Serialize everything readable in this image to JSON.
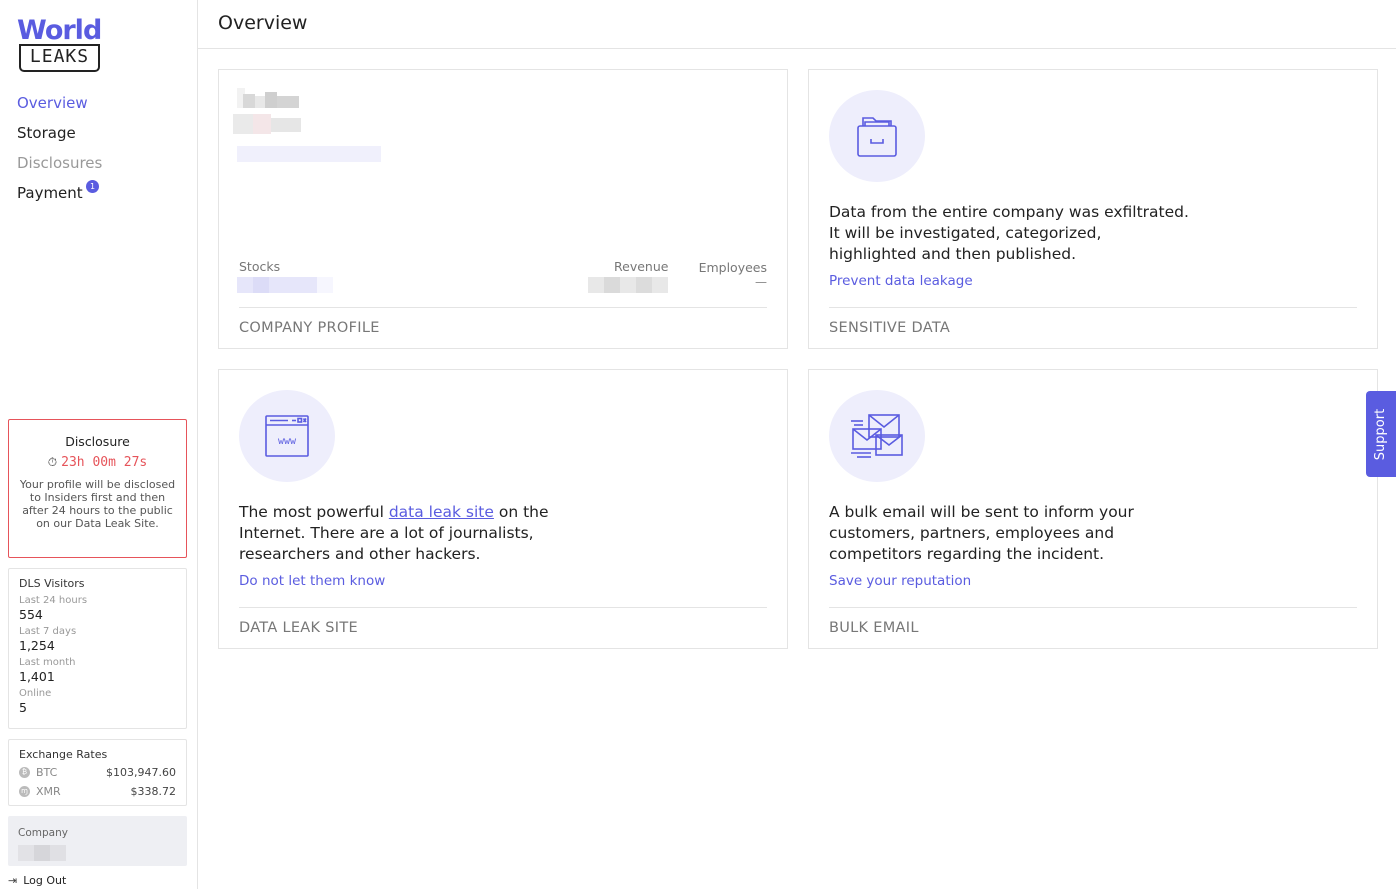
{
  "sidebar": {
    "logo": {
      "top": "World",
      "bottom": "LEAKS"
    },
    "nav": [
      {
        "label": "Overview",
        "state": "active"
      },
      {
        "label": "Storage",
        "state": "normal"
      },
      {
        "label": "Disclosures",
        "state": "muted"
      },
      {
        "label": "Payment",
        "state": "normal",
        "badge": "1"
      }
    ],
    "disclosure": {
      "title": "Disclosure",
      "timer": "23h 00m 27s",
      "text": "Your profile will be disclosed to Insiders first and then after 24 hours to the public on our Data Leak Site."
    },
    "visitors": {
      "title": "DLS Visitors",
      "stats": [
        {
          "label": "Last 24 hours",
          "value": "554"
        },
        {
          "label": "Last 7 days",
          "value": "1,254"
        },
        {
          "label": "Last month",
          "value": "1,401"
        },
        {
          "label": "Online",
          "value": "5"
        }
      ]
    },
    "rates": {
      "title": "Exchange Rates",
      "items": [
        {
          "name": "BTC",
          "value": "$103,947.60",
          "icon": "bitcoin-icon"
        },
        {
          "name": "XMR",
          "value": "$338.72",
          "icon": "monero-icon"
        }
      ]
    },
    "company": {
      "label": "Company"
    },
    "logout": "Log Out"
  },
  "header": {
    "title": "Overview"
  },
  "cards": {
    "profile": {
      "footer": "COMPANY PROFILE",
      "stocks_label": "Stocks",
      "revenue_label": "Revenue",
      "employees_label": "Employees",
      "employees_value": "—"
    },
    "sensitive": {
      "text": "Data from the entire company was exfiltrated. It will be investigated, categorized, highlighted and then published.",
      "link": "Prevent data leakage",
      "footer": "SENSITIVE DATA"
    },
    "dls": {
      "text_before": "The most powerful ",
      "text_link": "data leak site",
      "text_after": " on the Internet. There are a lot of journalists, researchers and other hackers.",
      "link": "Do not let them know",
      "footer": "DATA LEAK SITE"
    },
    "bulk": {
      "text": "A bulk email will be sent to inform your customers, partners, employees and competitors regarding the incident.",
      "link": "Save your reputation",
      "footer": "BULK EMAIL"
    }
  },
  "support": "Support",
  "colors": {
    "accent": "#5a5ce0",
    "danger": "#e6545a",
    "icon_bg": "#eeeefc"
  }
}
